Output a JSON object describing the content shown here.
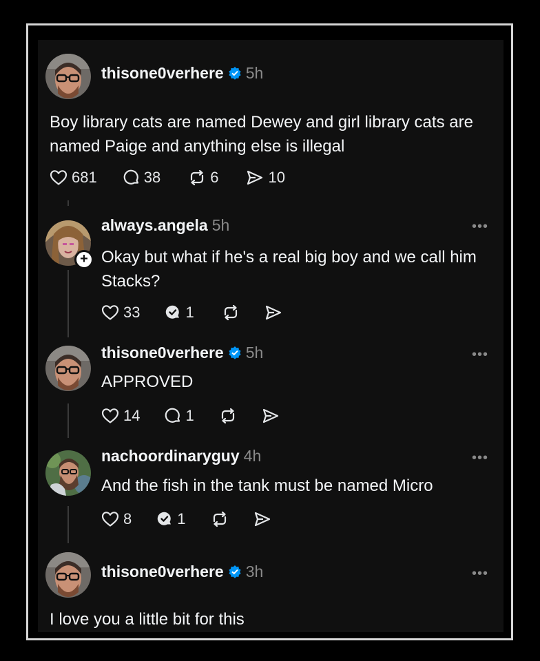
{
  "posts": [
    {
      "username": "thisone0verhere",
      "verified": true,
      "time": "5h",
      "text": "Boy library cats are named Dewey and girl library cats are named Paige and anything else is illegal",
      "likes": "681",
      "replies": "38",
      "reposts": "6",
      "shares": "10"
    },
    {
      "username": "always.angela",
      "verified": false,
      "time": "5h",
      "text": "Okay but what if he's a real big boy and we call him Stacks?",
      "likes": "33",
      "replies": "1"
    },
    {
      "username": "thisone0verhere",
      "verified": true,
      "time": "5h",
      "text": "APPROVED",
      "likes": "14",
      "replies": "1"
    },
    {
      "username": "nachoordinaryguy",
      "verified": false,
      "time": "4h",
      "text": "And the fish in the tank must be named Micro",
      "likes": "8",
      "replies": "1"
    },
    {
      "username": "thisone0verhere",
      "verified": true,
      "time": "3h",
      "text": "I love you a little bit for this"
    }
  ],
  "more_menu_label": "•••",
  "follow_badge_label": "+",
  "colors": {
    "background": "#101010",
    "verified": "#0095f6",
    "muted": "#8a8a8a",
    "text": "#f3f5f7"
  }
}
